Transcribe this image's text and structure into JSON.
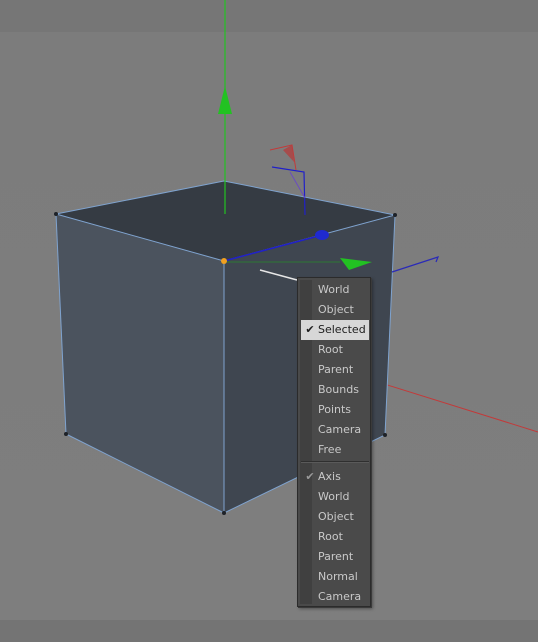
{
  "context_menu": {
    "group1": [
      {
        "label": "World",
        "checked": false
      },
      {
        "label": "Object",
        "checked": false
      },
      {
        "label": "Selected",
        "checked": true,
        "highlighted": true
      },
      {
        "label": "Root",
        "checked": false
      },
      {
        "label": "Parent",
        "checked": false
      },
      {
        "label": "Bounds",
        "checked": false
      },
      {
        "label": "Points",
        "checked": false
      },
      {
        "label": "Camera",
        "checked": false
      },
      {
        "label": "Free",
        "checked": false
      }
    ],
    "group2": [
      {
        "label": "Axis",
        "checked": true
      },
      {
        "label": "World",
        "checked": false
      },
      {
        "label": "Object",
        "checked": false
      },
      {
        "label": "Root",
        "checked": false
      },
      {
        "label": "Parent",
        "checked": false
      },
      {
        "label": "Normal",
        "checked": false
      },
      {
        "label": "Camera",
        "checked": false
      }
    ],
    "check_glyph": "✔"
  },
  "colors": {
    "cube_face_left": "#4b535e",
    "cube_face_right": "#3f4650",
    "cube_top": "#353b43",
    "cube_edge": "#7fa3cf",
    "axis_y": "#22c222",
    "axis_x": "#c23a3a",
    "axis_z": "#2020c8",
    "pivot": "#f0a020",
    "menu_bg": "#4a4a4a",
    "menu_highlight": "#d7d7d7"
  }
}
